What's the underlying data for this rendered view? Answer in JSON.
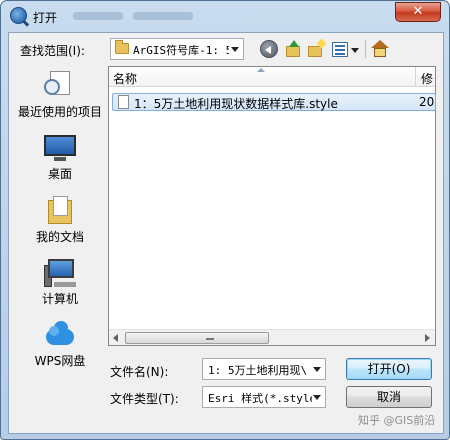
{
  "window": {
    "title": "打开",
    "close_label": "✕"
  },
  "toolbar": {
    "look_in_label": "查找范围(I):",
    "look_in_value": "ArGIS符号库-1: 5",
    "icons": [
      "back-icon",
      "up-folder-icon",
      "new-folder-icon",
      "views-icon",
      "home-icon"
    ]
  },
  "places": [
    {
      "label": "最近使用的项目",
      "icon": "recent-items-icon"
    },
    {
      "label": "桌面",
      "icon": "desktop-icon"
    },
    {
      "label": "我的文档",
      "icon": "documents-icon"
    },
    {
      "label": "计算机",
      "icon": "computer-icon"
    },
    {
      "label": "WPS网盘",
      "icon": "wps-cloud-icon"
    }
  ],
  "file_list": {
    "columns": [
      "名称",
      "修"
    ],
    "rows": [
      {
        "name": "1：5万土地利用现状数据样式库.style",
        "modified": "20"
      }
    ]
  },
  "bottom": {
    "filename_label": "文件名(N):",
    "filename_value": "1: 5万土地利用现\\",
    "filetype_label": "文件类型(T):",
    "filetype_value": "Esri 样式(*.style",
    "open_button": "打开(O)",
    "cancel_button": "取消"
  },
  "watermark": "知乎 @GIS前沿"
}
